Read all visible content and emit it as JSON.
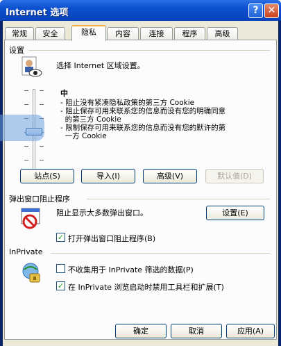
{
  "window": {
    "title": "Internet 选项",
    "help_glyph": "?",
    "close_glyph": "✕"
  },
  "tabs": [
    {
      "label": "常规"
    },
    {
      "label": "安全"
    },
    {
      "label": "隐私"
    },
    {
      "label": "内容"
    },
    {
      "label": "连接"
    },
    {
      "label": "程序"
    },
    {
      "label": "高级"
    }
  ],
  "active_tab": "隐私",
  "settings": {
    "group_label": "设置",
    "description": "选择 Internet 区域设置。",
    "level": "中",
    "bullets": [
      "- 阻止没有紧凑隐私政策的第三方 Cookie",
      "- 阻止保存可用来联系您的信息而没有您的明确同意",
      "  的第三方 Cookie",
      "- 限制保存可用来联系您的信息而没有您的默许的第",
      "  一方 Cookie"
    ],
    "buttons": {
      "sites": "站点(S)",
      "import": "导入(I)",
      "advanced": "高级(V)",
      "default": "默认值(D)"
    }
  },
  "popup": {
    "group_label": "弹出窗口阻止程序",
    "description": "阻止显示大多数弹出窗口。",
    "settings_button": "设置(E)",
    "checkbox_label": "打开弹出窗口阻止程序(B)",
    "checkbox_checked": true
  },
  "inprivate": {
    "group_label": "InPrivate",
    "option1_label": "不收集用于 InPrivate 筛选的数据(P)",
    "option1_checked": false,
    "option2_label": "在 InPrivate 浏览启动时禁用工具栏和扩展(T)",
    "option2_checked": true
  },
  "footer": {
    "ok": "确定",
    "cancel": "取消",
    "apply": "应用(A)"
  },
  "check_glyph": "✓"
}
